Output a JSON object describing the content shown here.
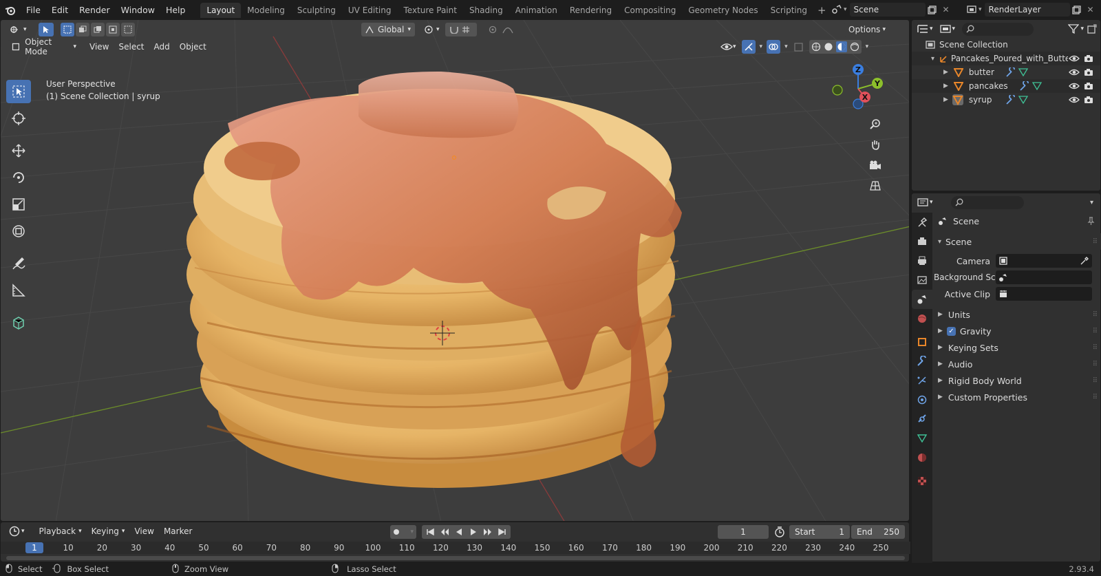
{
  "app": {
    "menu": [
      "File",
      "Edit",
      "Render",
      "Window",
      "Help"
    ],
    "workspaces": [
      "Layout",
      "Modeling",
      "Sculpting",
      "UV Editing",
      "Texture Paint",
      "Shading",
      "Animation",
      "Rendering",
      "Compositing",
      "Geometry Nodes",
      "Scripting"
    ],
    "active_workspace": "Layout",
    "scene_name": "Scene",
    "view_layer": "RenderLayer"
  },
  "viewport": {
    "orientation": "Global",
    "options_label": "Options",
    "mode": "Object Mode",
    "menus": [
      "View",
      "Select",
      "Add",
      "Object"
    ],
    "info_line1": "User Perspective",
    "info_line2": "(1) Scene Collection | syrup",
    "gizmo_axes": {
      "z": "Z",
      "y": "Y",
      "x": "X"
    }
  },
  "timeline": {
    "menus": [
      "Playback",
      "Keying",
      "View",
      "Marker"
    ],
    "current_frame": "1",
    "start_label": "Start",
    "start_value": "1",
    "end_label": "End",
    "end_value": "250",
    "ruler_ticks": [
      "1",
      "10",
      "20",
      "30",
      "40",
      "50",
      "60",
      "70",
      "80",
      "90",
      "100",
      "110",
      "120",
      "130",
      "140",
      "150",
      "160",
      "170",
      "180",
      "190",
      "200",
      "210",
      "220",
      "230",
      "240",
      "250"
    ]
  },
  "statusbar": {
    "select": "Select",
    "box_select": "Box Select",
    "zoom_view": "Zoom View",
    "lasso_select": "Lasso Select",
    "version": "2.93.4"
  },
  "outliner": {
    "root": "Scene Collection",
    "collection": "Pancakes_Poured_with_Butte",
    "objects": [
      "butter",
      "pancakes",
      "syrup"
    ]
  },
  "properties": {
    "context": "Scene",
    "panel_title": "Scene",
    "camera_label": "Camera",
    "bg_scene_label": "Background Sce...",
    "active_clip_label": "Active Clip",
    "subpanels": [
      "Units",
      "Gravity",
      "Keying Sets",
      "Audio",
      "Rigid Body World",
      "Custom Properties"
    ],
    "gravity_checked": true
  },
  "colors": {
    "accent": "#4772b3",
    "axis_x": "#e0505a",
    "axis_y": "#8cbf2b",
    "axis_z": "#3a7ee0",
    "object_orange": "#e8862a",
    "mesh_green": "#3fc196"
  }
}
